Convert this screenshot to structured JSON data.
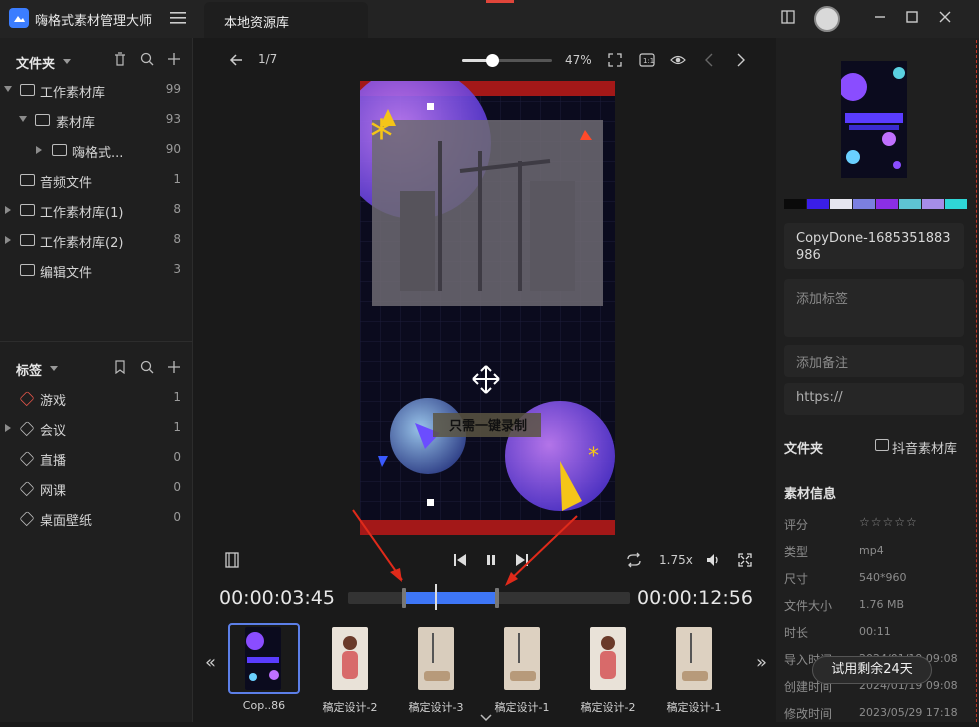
{
  "app": {
    "title": "嗨格式素材管理大师",
    "tab": "本地资源库"
  },
  "sidebar": {
    "folders_title": "文件夹",
    "folders": [
      {
        "label": "工作素材库",
        "count": "99"
      },
      {
        "label": "素材库",
        "count": "93"
      },
      {
        "label": "嗨格式...",
        "count": "90"
      },
      {
        "label": "音频文件",
        "count": "1"
      },
      {
        "label": "工作素材库(1)",
        "count": "8"
      },
      {
        "label": "工作素材库(2)",
        "count": "8"
      },
      {
        "label": "编辑文件",
        "count": "3"
      }
    ],
    "tags_title": "标签",
    "tags": [
      {
        "label": "游戏",
        "count": "1"
      },
      {
        "label": "会议",
        "count": "1"
      },
      {
        "label": "直播",
        "count": "0"
      },
      {
        "label": "网课",
        "count": "0"
      },
      {
        "label": "桌面壁纸",
        "count": "0"
      }
    ]
  },
  "viewer": {
    "page": "1/7",
    "zoom": "47%",
    "zoom_level": 0.47,
    "caption": "只需一键录制",
    "speed": "1.75x",
    "current_time": "00:00:03:45",
    "total_time": "00:00:12:56"
  },
  "filmstrip": [
    {
      "label": "Cop..86"
    },
    {
      "label": "稿定设计-2"
    },
    {
      "label": "稿定设计-3"
    },
    {
      "label": "稿定设计-1"
    },
    {
      "label": "稿定设计-2"
    },
    {
      "label": "稿定设计-1"
    }
  ],
  "details": {
    "filename": "CopyDone-1685351883986",
    "tag_placeholder": "添加标签",
    "note_placeholder": "添加备注",
    "url_placeholder": "https://",
    "folder_label": "文件夹",
    "folder_value": "抖音素材库",
    "info_title": "素材信息",
    "rows": [
      {
        "k": "评分",
        "v": "☆☆☆☆☆"
      },
      {
        "k": "类型",
        "v": "mp4"
      },
      {
        "k": "尺寸",
        "v": "540*960"
      },
      {
        "k": "文件大小",
        "v": "1.76 MB"
      },
      {
        "k": "时长",
        "v": "00:11"
      },
      {
        "k": "导入时间",
        "v": "2024/01/19 09:08"
      },
      {
        "k": "创建时间",
        "v": "2024/01/19 09:08"
      },
      {
        "k": "修改时间",
        "v": "2023/05/29 17:18"
      }
    ],
    "palette": [
      "#0a0a0a",
      "#3a1ee8",
      "#e6e6f0",
      "#7b7fe0",
      "#8a2fe6",
      "#5ec4d4",
      "#a58de8",
      "#2fd6d6"
    ]
  },
  "trial": "试用剩余24天"
}
